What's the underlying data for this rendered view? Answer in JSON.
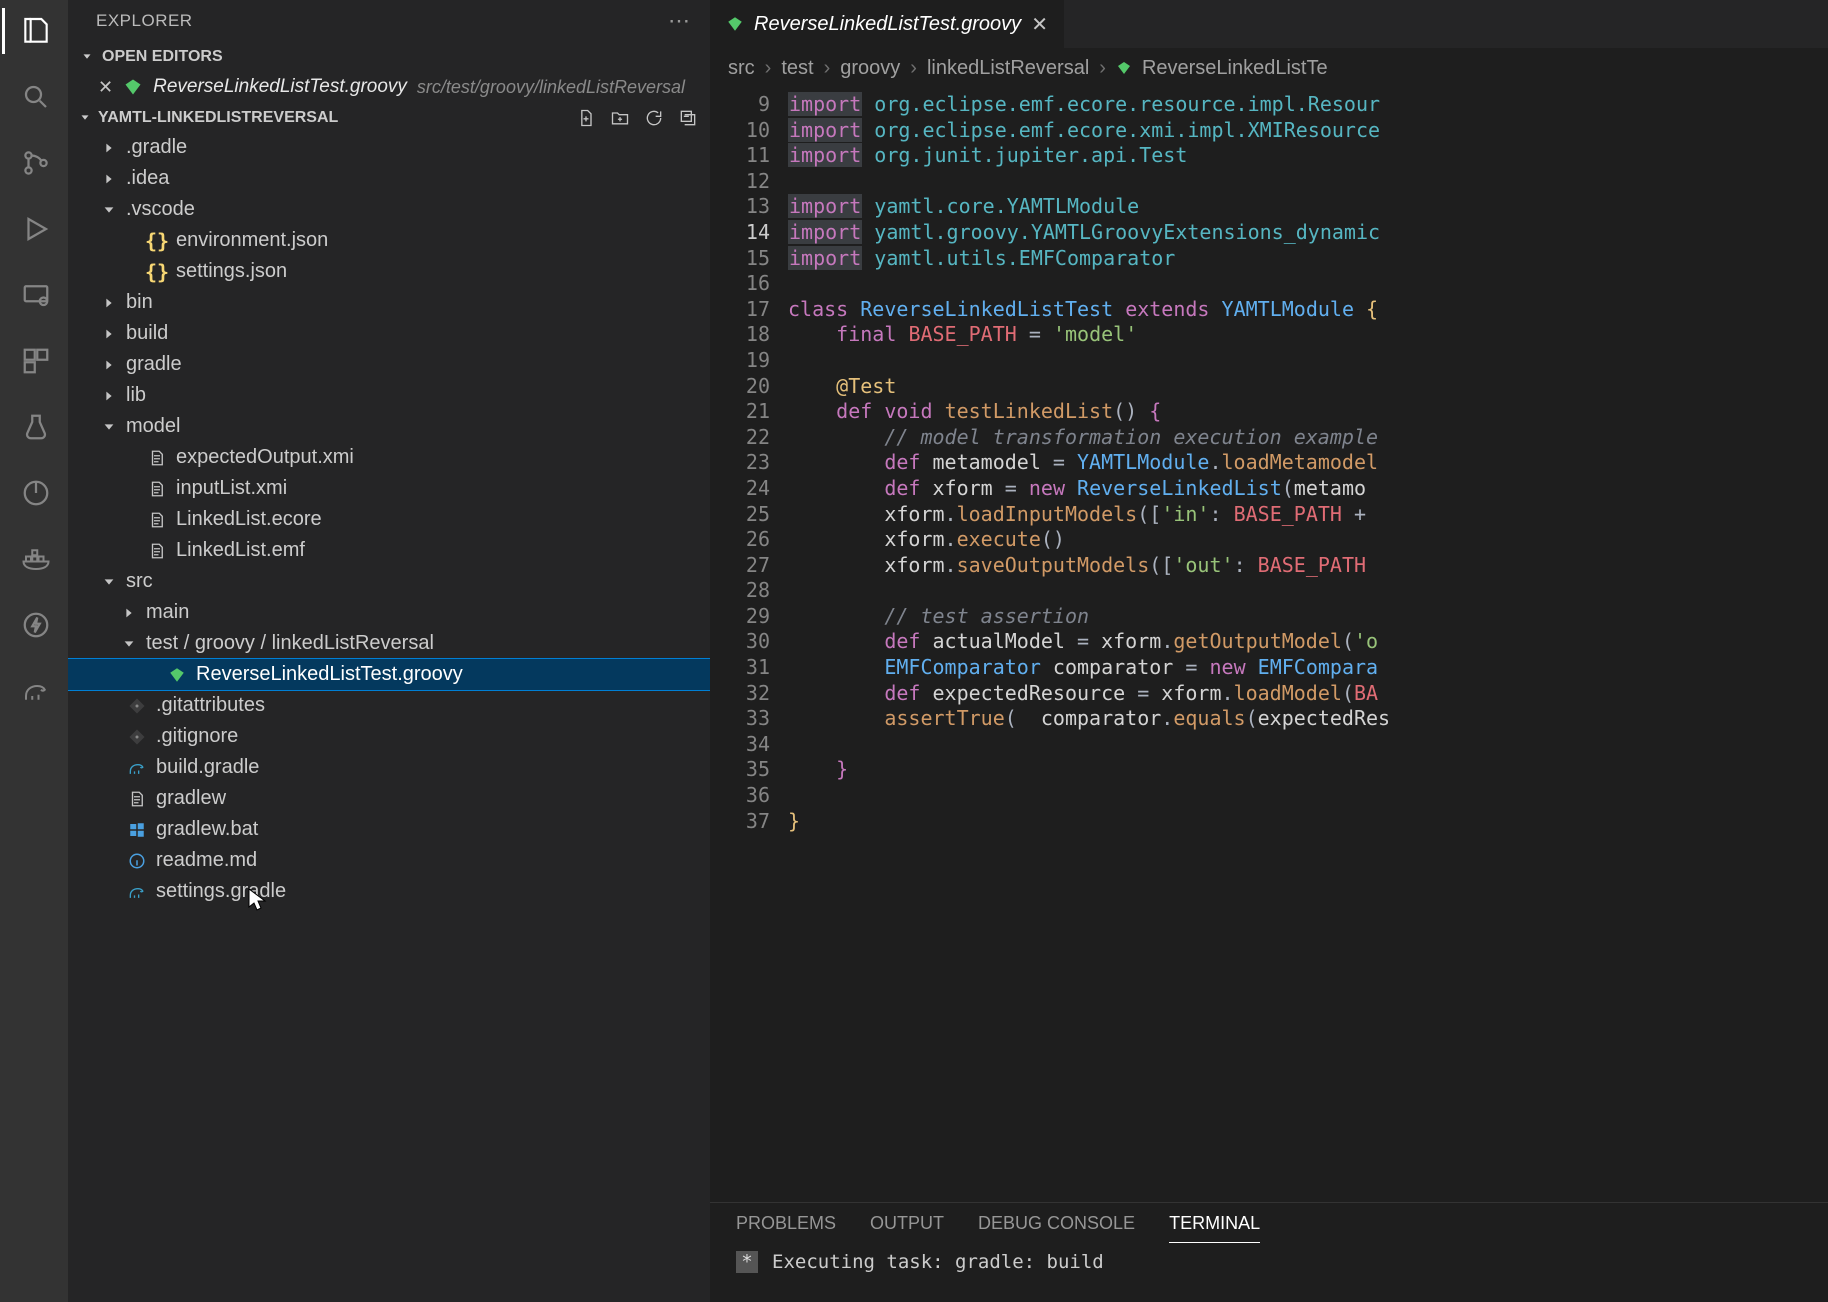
{
  "sidebar": {
    "title": "EXPLORER",
    "openEditorsLabel": "OPEN EDITORS",
    "openEditor": {
      "file": "ReverseLinkedListTest.groovy",
      "path": "src/test/groovy/linkedListReversal"
    },
    "projectLabel": "YAMTL-LINKEDLISTREVERSAL",
    "tree": [
      {
        "kind": "folder",
        "expand": "closed",
        "depth": 0,
        "label": ".gradle"
      },
      {
        "kind": "folder",
        "expand": "closed",
        "depth": 0,
        "label": ".idea"
      },
      {
        "kind": "folder",
        "expand": "open",
        "depth": 0,
        "label": ".vscode"
      },
      {
        "kind": "file",
        "icon": "json",
        "depth": 1,
        "label": "environment.json"
      },
      {
        "kind": "file",
        "icon": "json",
        "depth": 1,
        "label": "settings.json"
      },
      {
        "kind": "folder",
        "expand": "closed",
        "depth": 0,
        "label": "bin"
      },
      {
        "kind": "folder",
        "expand": "closed",
        "depth": 0,
        "label": "build"
      },
      {
        "kind": "folder",
        "expand": "closed",
        "depth": 0,
        "label": "gradle"
      },
      {
        "kind": "folder",
        "expand": "closed",
        "depth": 0,
        "label": "lib"
      },
      {
        "kind": "folder",
        "expand": "open",
        "depth": 0,
        "label": "model"
      },
      {
        "kind": "file",
        "icon": "file",
        "depth": 1,
        "label": "expectedOutput.xmi"
      },
      {
        "kind": "file",
        "icon": "file",
        "depth": 1,
        "label": "inputList.xmi"
      },
      {
        "kind": "file",
        "icon": "file",
        "depth": 1,
        "label": "LinkedList.ecore"
      },
      {
        "kind": "file",
        "icon": "file",
        "depth": 1,
        "label": "LinkedList.emf"
      },
      {
        "kind": "folder",
        "expand": "open",
        "depth": 0,
        "label": "src"
      },
      {
        "kind": "folder",
        "expand": "closed",
        "depth": 1,
        "label": "main"
      },
      {
        "kind": "folderpath",
        "expand": "open",
        "depth": 1,
        "label": "test / groovy / linkedListReversal"
      },
      {
        "kind": "file",
        "icon": "groovy",
        "depth": 2,
        "label": "ReverseLinkedListTest.groovy",
        "selected": true
      },
      {
        "kind": "file",
        "icon": "git",
        "depth": 0,
        "label": ".gitattributes"
      },
      {
        "kind": "file",
        "icon": "git",
        "depth": 0,
        "label": ".gitignore"
      },
      {
        "kind": "file",
        "icon": "gradle",
        "depth": 0,
        "label": "build.gradle"
      },
      {
        "kind": "file",
        "icon": "file",
        "depth": 0,
        "label": "gradlew"
      },
      {
        "kind": "file",
        "icon": "win",
        "depth": 0,
        "label": "gradlew.bat"
      },
      {
        "kind": "file",
        "icon": "info",
        "depth": 0,
        "label": "readme.md"
      },
      {
        "kind": "file",
        "icon": "gradle",
        "depth": 0,
        "label": "settings.gradle"
      }
    ]
  },
  "editor": {
    "tabLabel": "ReverseLinkedListTest.groovy",
    "breadcrumbs": [
      "src",
      "test",
      "groovy",
      "linkedListReversal",
      "ReverseLinkedListTe"
    ],
    "firstLine": 9,
    "currentLine": 14,
    "lastLine": 37,
    "lines": [
      [
        [
          "kw-bg",
          "import"
        ],
        [
          "sp",
          " "
        ],
        [
          "pkg",
          "org.eclipse.emf.ecore.resource.impl.Resour"
        ]
      ],
      [
        [
          "kw-bg",
          "import"
        ],
        [
          "sp",
          " "
        ],
        [
          "pkg",
          "org.eclipse.emf.ecore.xmi.impl.XMIResource"
        ]
      ],
      [
        [
          "kw-bg",
          "import"
        ],
        [
          "sp",
          " "
        ],
        [
          "pkg",
          "org.junit.jupiter.api.Test"
        ]
      ],
      [],
      [
        [
          "kw-bg",
          "import"
        ],
        [
          "sp",
          " "
        ],
        [
          "pkg",
          "yamtl.core.YAMTLModule"
        ]
      ],
      [
        [
          "kw-bg",
          "import"
        ],
        [
          "sp",
          " "
        ],
        [
          "pkg",
          "yamtl.groovy.YAMTLGroovyExtensions_dynamic"
        ]
      ],
      [
        [
          "kw-bg",
          "import"
        ],
        [
          "sp",
          " "
        ],
        [
          "pkg",
          "yamtl.utils.EMFComparator"
        ]
      ],
      [],
      [
        [
          "kw",
          "class"
        ],
        [
          "sp",
          " "
        ],
        [
          "cls",
          "ReverseLinkedListTest"
        ],
        [
          "sp",
          " "
        ],
        [
          "kw",
          "extends"
        ],
        [
          "sp",
          " "
        ],
        [
          "cls",
          "YAMTLModule"
        ],
        [
          "sp",
          " "
        ],
        [
          "bracey",
          "{"
        ]
      ],
      [
        [
          "ind",
          "    "
        ],
        [
          "kw",
          "final"
        ],
        [
          "sp",
          " "
        ],
        [
          "const",
          "BASE_PATH"
        ],
        [
          "sp",
          " "
        ],
        [
          "punc",
          "="
        ],
        [
          "sp",
          " "
        ],
        [
          "str",
          "'model'"
        ]
      ],
      [],
      [
        [
          "ind",
          "    "
        ],
        [
          "dec",
          "@Test"
        ]
      ],
      [
        [
          "ind",
          "    "
        ],
        [
          "kw",
          "def"
        ],
        [
          "sp",
          " "
        ],
        [
          "kw",
          "void"
        ],
        [
          "sp",
          " "
        ],
        [
          "fn",
          "testLinkedList"
        ],
        [
          "punc",
          "()"
        ],
        [
          "sp",
          " "
        ],
        [
          "bracem",
          "{"
        ]
      ],
      [
        [
          "ind",
          "        "
        ],
        [
          "com",
          "// model transformation execution example"
        ]
      ],
      [
        [
          "ind",
          "        "
        ],
        [
          "kw",
          "def"
        ],
        [
          "sp",
          " "
        ],
        [
          "id",
          "metamodel"
        ],
        [
          "sp",
          " "
        ],
        [
          "punc",
          "="
        ],
        [
          "sp",
          " "
        ],
        [
          "cls",
          "YAMTLModule"
        ],
        [
          "punc",
          "."
        ],
        [
          "fn",
          "loadMetamodel"
        ]
      ],
      [
        [
          "ind",
          "        "
        ],
        [
          "kw",
          "def"
        ],
        [
          "sp",
          " "
        ],
        [
          "id",
          "xform"
        ],
        [
          "sp",
          " "
        ],
        [
          "punc",
          "="
        ],
        [
          "sp",
          " "
        ],
        [
          "kw",
          "new"
        ],
        [
          "sp",
          " "
        ],
        [
          "cls",
          "ReverseLinkedList"
        ],
        [
          "punc",
          "("
        ],
        [
          "id",
          "metamo"
        ]
      ],
      [
        [
          "ind",
          "        "
        ],
        [
          "id",
          "xform"
        ],
        [
          "punc",
          "."
        ],
        [
          "fn",
          "loadInputModels"
        ],
        [
          "punc",
          "(["
        ],
        [
          "str",
          "'in'"
        ],
        [
          "punc",
          ": "
        ],
        [
          "const",
          "BASE_PATH"
        ],
        [
          "sp",
          " "
        ],
        [
          "punc",
          "+"
        ]
      ],
      [
        [
          "ind",
          "        "
        ],
        [
          "id",
          "xform"
        ],
        [
          "punc",
          "."
        ],
        [
          "fn",
          "execute"
        ],
        [
          "punc",
          "()"
        ]
      ],
      [
        [
          "ind",
          "        "
        ],
        [
          "id",
          "xform"
        ],
        [
          "punc",
          "."
        ],
        [
          "fn",
          "saveOutputModels"
        ],
        [
          "punc",
          "(["
        ],
        [
          "str",
          "'out'"
        ],
        [
          "punc",
          ": "
        ],
        [
          "const",
          "BASE_PATH"
        ]
      ],
      [],
      [
        [
          "ind",
          "        "
        ],
        [
          "com",
          "// test assertion"
        ]
      ],
      [
        [
          "ind",
          "        "
        ],
        [
          "kw",
          "def"
        ],
        [
          "sp",
          " "
        ],
        [
          "id",
          "actualModel"
        ],
        [
          "sp",
          " "
        ],
        [
          "punc",
          "="
        ],
        [
          "sp",
          " "
        ],
        [
          "id",
          "xform"
        ],
        [
          "punc",
          "."
        ],
        [
          "fn",
          "getOutputModel"
        ],
        [
          "punc",
          "("
        ],
        [
          "str",
          "'o"
        ]
      ],
      [
        [
          "ind",
          "        "
        ],
        [
          "cls",
          "EMFComparator"
        ],
        [
          "sp",
          " "
        ],
        [
          "id",
          "comparator"
        ],
        [
          "sp",
          " "
        ],
        [
          "punc",
          "="
        ],
        [
          "sp",
          " "
        ],
        [
          "kw",
          "new"
        ],
        [
          "sp",
          " "
        ],
        [
          "cls",
          "EMFCompara"
        ]
      ],
      [
        [
          "ind",
          "        "
        ],
        [
          "kw",
          "def"
        ],
        [
          "sp",
          " "
        ],
        [
          "id",
          "expectedResource"
        ],
        [
          "sp",
          " "
        ],
        [
          "punc",
          "="
        ],
        [
          "sp",
          " "
        ],
        [
          "id",
          "xform"
        ],
        [
          "punc",
          "."
        ],
        [
          "fn",
          "loadModel"
        ],
        [
          "punc",
          "("
        ],
        [
          "const",
          "BA"
        ]
      ],
      [
        [
          "ind",
          "        "
        ],
        [
          "fn",
          "assertTrue"
        ],
        [
          "punc",
          "(  "
        ],
        [
          "id",
          "comparator"
        ],
        [
          "punc",
          "."
        ],
        [
          "fn",
          "equals"
        ],
        [
          "punc",
          "("
        ],
        [
          "id",
          "expectedRes"
        ]
      ],
      [],
      [
        [
          "ind",
          "    "
        ],
        [
          "bracem",
          "}"
        ]
      ],
      [],
      [
        [
          "bracey",
          "}"
        ]
      ]
    ]
  },
  "panel": {
    "tabs": [
      "PROBLEMS",
      "OUTPUT",
      "DEBUG CONSOLE",
      "TERMINAL"
    ],
    "activeTab": "TERMINAL",
    "bodyPrefix": "*",
    "body": "Executing task: gradle: build"
  }
}
